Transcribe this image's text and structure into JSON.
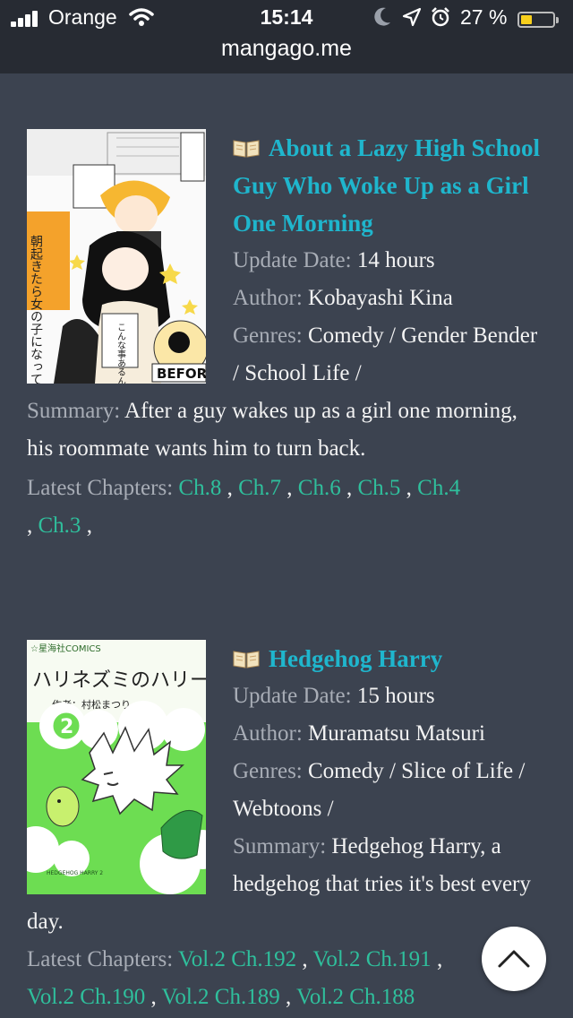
{
  "status_bar": {
    "carrier": "Orange",
    "time": "15:14",
    "battery_percent": "27 %",
    "battery_level": 0.27,
    "battery_color": "#f7cf1c",
    "icons": [
      "signal-icon",
      "wifi-icon",
      "moon-icon",
      "location-icon",
      "alarm-icon",
      "battery-icon"
    ]
  },
  "url_bar": {
    "domain": "mangago.me"
  },
  "colors": {
    "title": "#1fb6cd",
    "chapter_link": "#2fbf9c",
    "label": "#a8adb6",
    "background": "#3c4350"
  },
  "entries": [
    {
      "title": "About a Lazy High School Guy Who Woke Up as a Girl One Morning",
      "cover_text": {
        "vertical_title": "朝起きたら女の子になっていた",
        "before_badge": "BEFORE",
        "bubble": "こんな事あるんだな…"
      },
      "update_label": "Update Date:",
      "update_value": "14 hours",
      "author_label": "Author:",
      "author_value": "Kobayashi Kina",
      "genres_label": "Genres:",
      "genres_value": "Comedy / Gender Bender / School Life /",
      "summary_label": "Summary:",
      "summary_value": "After a guy wakes up as a girl one morning, his roommate wants him to turn back.",
      "latest_label": "Latest Chapters:",
      "chapters": [
        "Ch.8",
        "Ch.7",
        "Ch.6",
        "Ch.5",
        "Ch.4",
        "Ch.3"
      ]
    },
    {
      "title": "Hedgehog Harry",
      "cover_text": {
        "publisher": "☆星海社COMICS",
        "jp_title": "ハリネズミのハリー",
        "author_line": "作者：村松まつり",
        "volume": "2",
        "bottom_line": "HEDGEHOG HARRY 2"
      },
      "update_label": "Update Date:",
      "update_value": "15 hours",
      "author_label": "Author:",
      "author_value": "Muramatsu Matsuri",
      "genres_label": "Genres:",
      "genres_value": "Comedy / Slice of Life / Webtoons /",
      "summary_label": "Summary:",
      "summary_value": "Hedgehog Harry, a hedgehog that tries it's best every day.",
      "latest_label": "Latest Chapters:",
      "chapters": [
        "Vol.2 Ch.192",
        "Vol.2 Ch.191",
        "Vol.2 Ch.190",
        "Vol.2 Ch.189",
        "Vol.2 Ch.188"
      ]
    }
  ]
}
